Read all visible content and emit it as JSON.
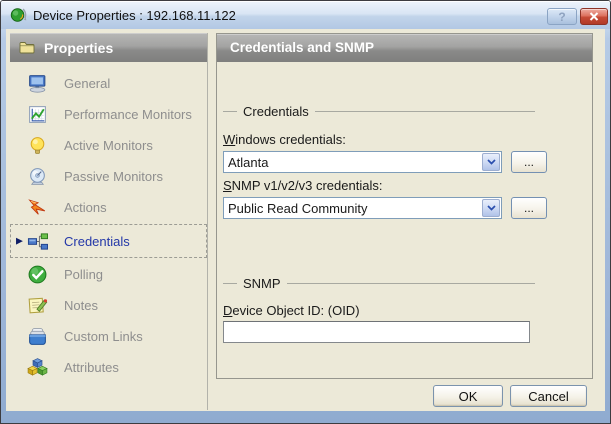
{
  "window": {
    "title": "Device Properties : 192.168.11.122",
    "help": "?"
  },
  "sidebar": {
    "header": "Properties",
    "selected": "Credentials",
    "items": [
      {
        "label": "General",
        "icon": "monitor-icon"
      },
      {
        "label": "Performance Monitors",
        "icon": "chart-icon"
      },
      {
        "label": "Active Monitors",
        "icon": "lightbulb-icon"
      },
      {
        "label": "Passive Monitors",
        "icon": "dish-icon"
      },
      {
        "label": "Actions",
        "icon": "orange-arrow-icon"
      },
      {
        "label": "Credentials",
        "icon": "org-chart-icon"
      },
      {
        "label": "Polling",
        "icon": "green-check-icon"
      },
      {
        "label": "Notes",
        "icon": "notepad-icon"
      },
      {
        "label": "Custom Links",
        "icon": "links-box-icon"
      },
      {
        "label": "Attributes",
        "icon": "cubes-icon"
      }
    ]
  },
  "main": {
    "header": "Credentials and SNMP",
    "credentials_group": {
      "legend": "Credentials",
      "windows": {
        "mnemonic": "W",
        "label_rest": "indows credentials:",
        "value": "Atlanta"
      },
      "snmp": {
        "mnemonic": "S",
        "label_rest": "NMP v1/v2/v3 credentials:",
        "value": "Public Read Community"
      },
      "browse_label": "..."
    },
    "snmp_group": {
      "legend": "SNMP",
      "oid": {
        "mnemonic": "D",
        "label_rest": "evice Object ID: (OID)",
        "value": ""
      }
    },
    "buttons": {
      "ok": "OK",
      "cancel": "Cancel"
    }
  },
  "colors": {
    "client_bg": "#ece9d8",
    "header_gray": "#8a8a89",
    "selected_text": "#2438a8",
    "combo_border": "#7f9db9",
    "titlebar_blue": "#b2c8e4",
    "close_red": "#c64a36"
  }
}
